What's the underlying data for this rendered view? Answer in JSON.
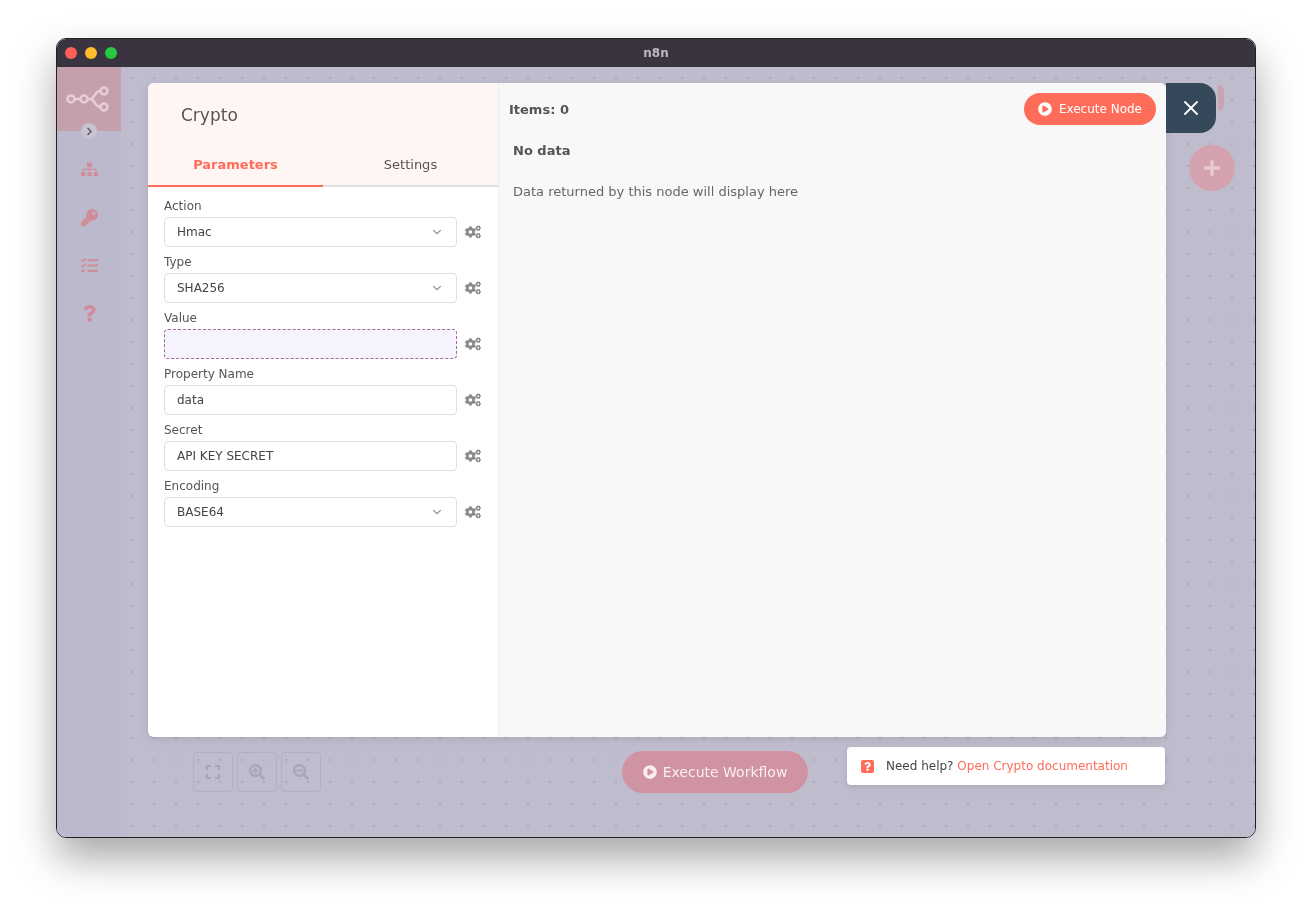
{
  "window": {
    "title": "n8n"
  },
  "canvas": {
    "execute_button": "Execute Workflow"
  },
  "node_panel": {
    "title": "Crypto",
    "tabs": [
      {
        "label": "Parameters",
        "selected": true
      },
      {
        "label": "Settings",
        "selected": false
      }
    ],
    "parameters": [
      {
        "label": "Action",
        "kind": "select",
        "value": "Hmac"
      },
      {
        "label": "Type",
        "kind": "select",
        "value": "SHA256"
      },
      {
        "label": "Value",
        "kind": "empty"
      },
      {
        "label": "Property Name",
        "kind": "text",
        "value": "data"
      },
      {
        "label": "Secret",
        "kind": "text",
        "value": "API KEY SECRET"
      },
      {
        "label": "Encoding",
        "kind": "select",
        "value": "BASE64"
      }
    ]
  },
  "output": {
    "items": "Items: 0",
    "execute_button": "Execute Node",
    "empty_title": "No data",
    "empty_message": "Data returned by this node will display here"
  },
  "help": {
    "prefix": "Need help?",
    "link": "Open Crypto documentation"
  }
}
